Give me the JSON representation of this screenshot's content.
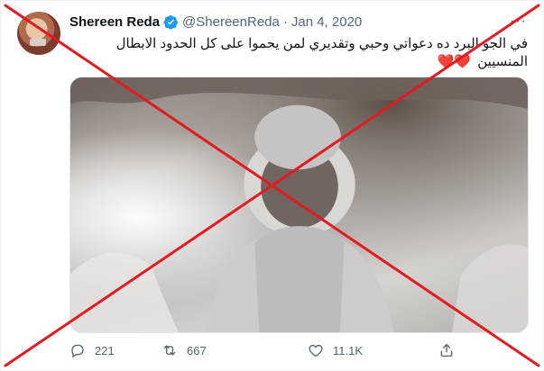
{
  "tweet": {
    "author_name": "Shereen Reda",
    "author_handle": "@ShereenReda",
    "separator": "·",
    "date": "Jan 4, 2020",
    "text": "في الجو البرد ده دعواتي وحبي وتقديري لمن يحموا على كل الحدود الابطال المنسيين",
    "emoji": "❤️❤️",
    "verified": true
  },
  "actions": {
    "replies": "221",
    "retweets": "667",
    "likes": "11.1K"
  },
  "icons": {
    "verified": "verified-badge-icon",
    "more": "more-icon",
    "reply": "reply-icon",
    "retweet": "retweet-icon",
    "like": "heart-icon",
    "share": "share-icon"
  },
  "colors": {
    "verified": "#1d9bf0",
    "text": "#0f1419",
    "muted": "#536471",
    "overlay_x": "#e21b23"
  }
}
